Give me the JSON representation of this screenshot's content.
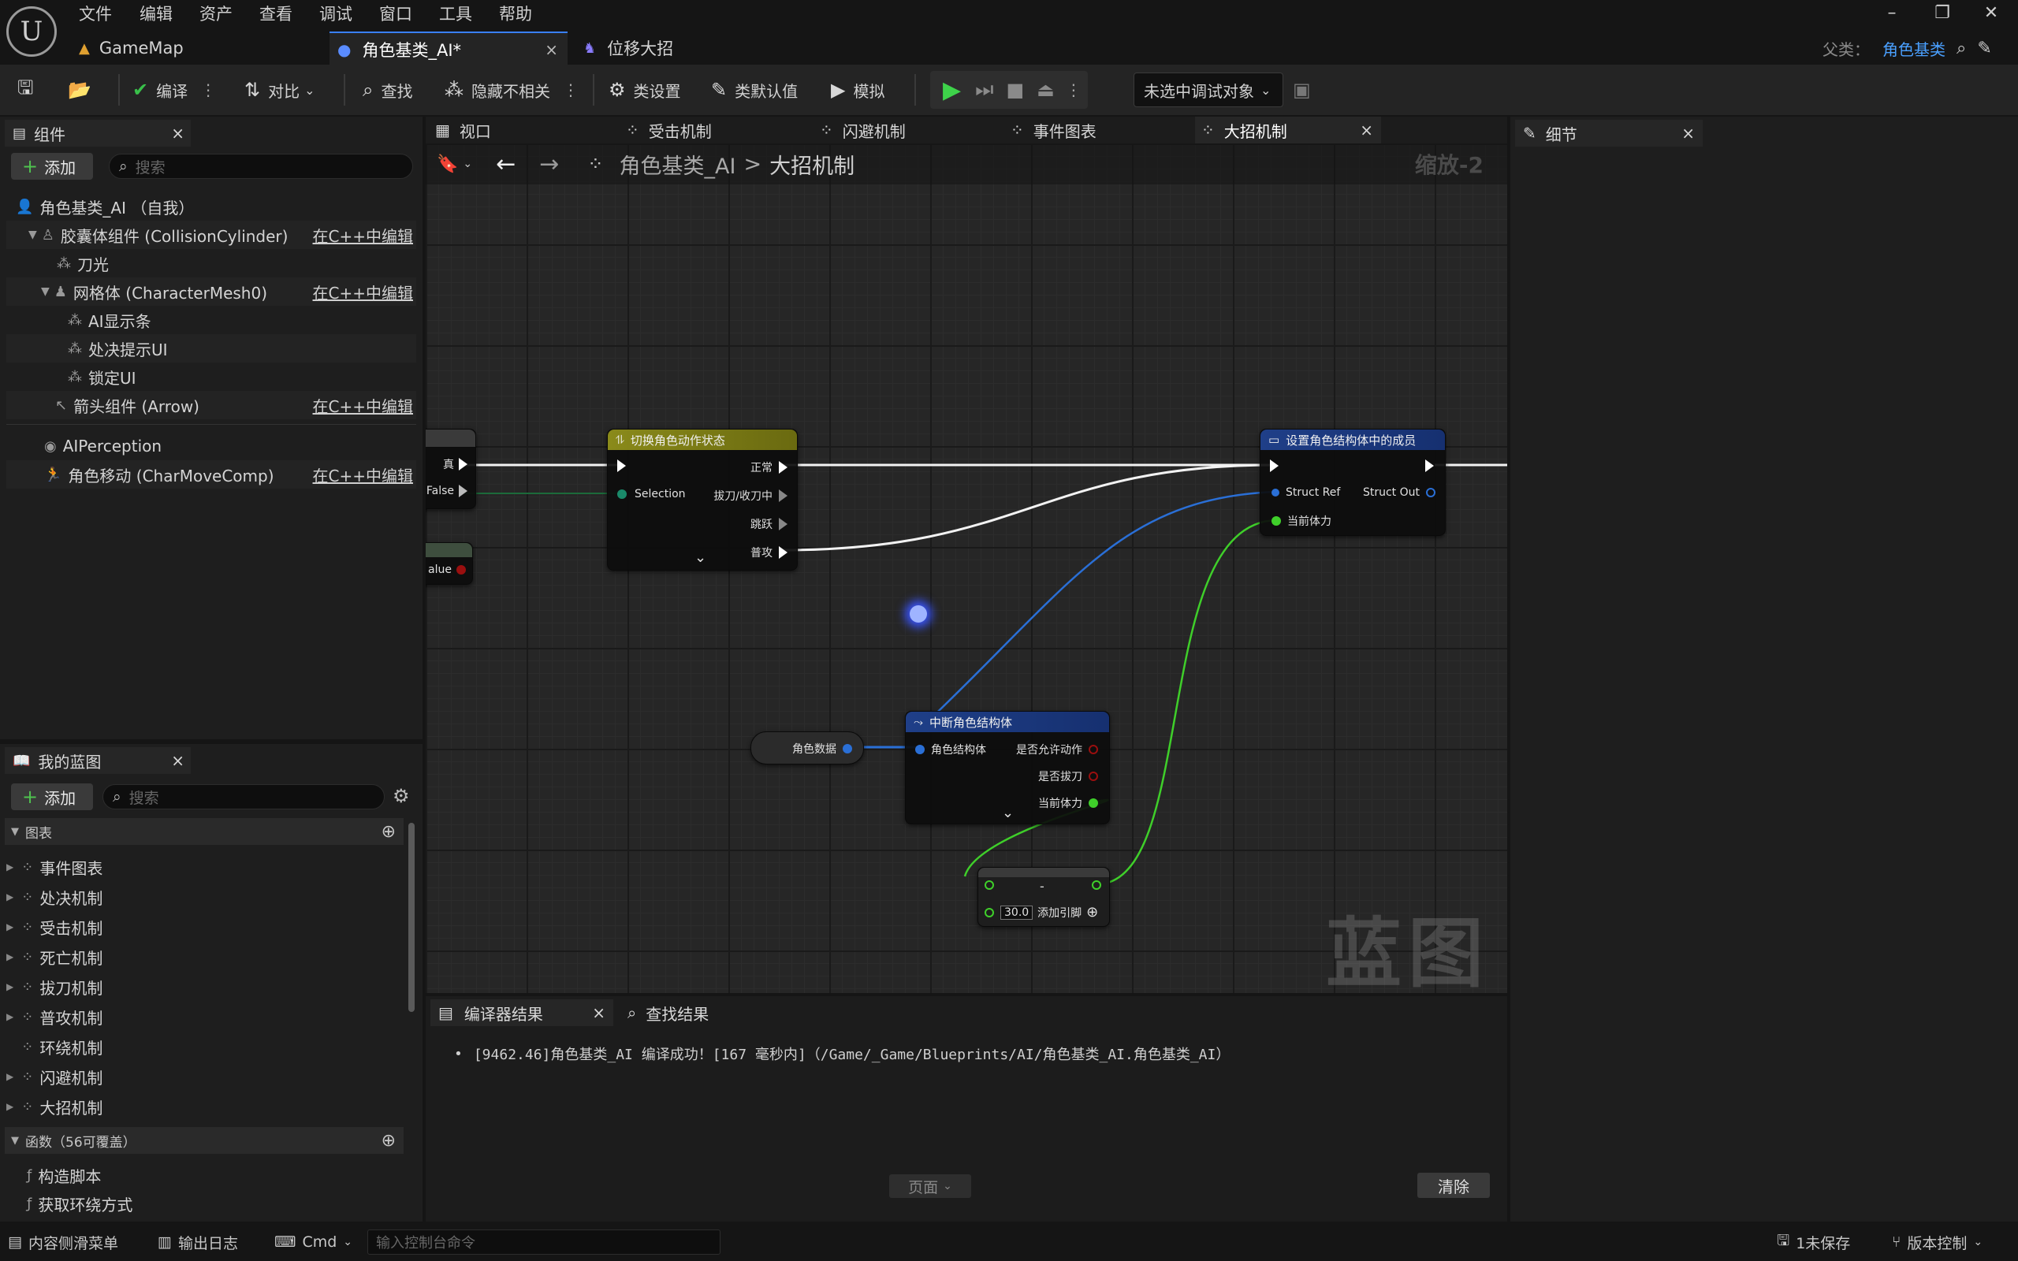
{
  "menu": [
    "文件",
    "编辑",
    "资产",
    "查看",
    "调试",
    "窗口",
    "工具",
    "帮助"
  ],
  "doc_tabs": [
    {
      "label": "GameMap"
    },
    {
      "label": "角色基类_AI*"
    },
    {
      "label": "位移大招"
    }
  ],
  "parent": {
    "label": "父类：",
    "value": "角色基类"
  },
  "toolbar": {
    "compile": "编译",
    "diff": "对比",
    "find": "查找",
    "hide_unrelated": "隐藏不相关",
    "class_settings": "类设置",
    "class_defaults": "类默认值",
    "simulate": "模拟",
    "debug_target": "未选中调试对象"
  },
  "components_panel": {
    "title": "组件",
    "add": "添加",
    "search_placeholder": "搜索",
    "items": [
      {
        "label": "角色基类_AI （自我）",
        "link": ""
      },
      {
        "label": "胶囊体组件 (CollisionCylinder)",
        "link": "在C++中编辑"
      },
      {
        "label": "刀光",
        "link": ""
      },
      {
        "label": "网格体 (CharacterMesh0)",
        "link": "在C++中编辑"
      },
      {
        "label": "AI显示条",
        "link": ""
      },
      {
        "label": "处决提示UI",
        "link": ""
      },
      {
        "label": "锁定UI",
        "link": ""
      },
      {
        "label": "箭头组件 (Arrow)",
        "link": "在C++中编辑"
      },
      {
        "label": "AIPerception",
        "link": ""
      },
      {
        "label": "角色移动 (CharMoveComp)",
        "link": "在C++中编辑"
      }
    ]
  },
  "mybp_panel": {
    "title": "我的蓝图",
    "add": "添加",
    "search_placeholder": "搜索",
    "graphs_header": "图表",
    "graphs": [
      "事件图表",
      "处决机制",
      "受击机制",
      "死亡机制",
      "拔刀机制",
      "普攻机制",
      "环绕机制",
      "闪避机制",
      "大招机制"
    ],
    "functions_header": "函数（56可覆盖）",
    "functions": [
      "构造脚本",
      "获取环绕方式"
    ]
  },
  "graph_tabs": [
    "视口",
    "受击机制",
    "闪避机制",
    "事件图表",
    "大招机制"
  ],
  "breadcrumb": {
    "root": "角色基类_AI",
    "sep": ">",
    "current": "大招机制",
    "zoom": "缩放-2"
  },
  "watermark": "蓝图",
  "nodes": {
    "branch": {
      "true": "真",
      "false": "False"
    },
    "value_stub": "alue",
    "switch": {
      "title": "切换角色动作状态",
      "selection": "Selection",
      "outs": [
        "正常",
        "拔刀/收刀中",
        "跳跃",
        "普攻"
      ]
    },
    "set_member": {
      "title": "设置角色结构体中的成员",
      "struct_ref": "Struct Ref",
      "struct_out": "Struct Out",
      "member": "当前体力"
    },
    "role_data": "角色数据",
    "break": {
      "title": "中断角色结构体",
      "in": "角色结构体",
      "outs": [
        "是否允许动作",
        "是否拔刀",
        "当前体力"
      ]
    },
    "subtract": {
      "op": "-",
      "value": "30.0",
      "add_pin": "添加引脚"
    }
  },
  "output_panel": {
    "tabs": [
      "编译器结果",
      "查找结果"
    ],
    "message": "[9462.46]角色基类_AI 编译成功！[167 毫秒内]（/Game/_Game/Blueprints/AI/角色基类_AI.角色基类_AI）",
    "page": "页面",
    "clear": "清除"
  },
  "details_panel": {
    "title": "细节"
  },
  "statusbar": {
    "content_drawer": "内容侧滑菜单",
    "output_log": "输出日志",
    "cmd": "Cmd",
    "console_placeholder": "输入控制台命令",
    "unsaved": "1未保存",
    "source_control": "版本控制"
  },
  "colors": {
    "accent": "#3a80ff",
    "exec": "#ffffff",
    "struct_pin": "#2a6fd6",
    "float_pin": "#3fcf2a",
    "bool_pin": "#9a0f0f"
  }
}
